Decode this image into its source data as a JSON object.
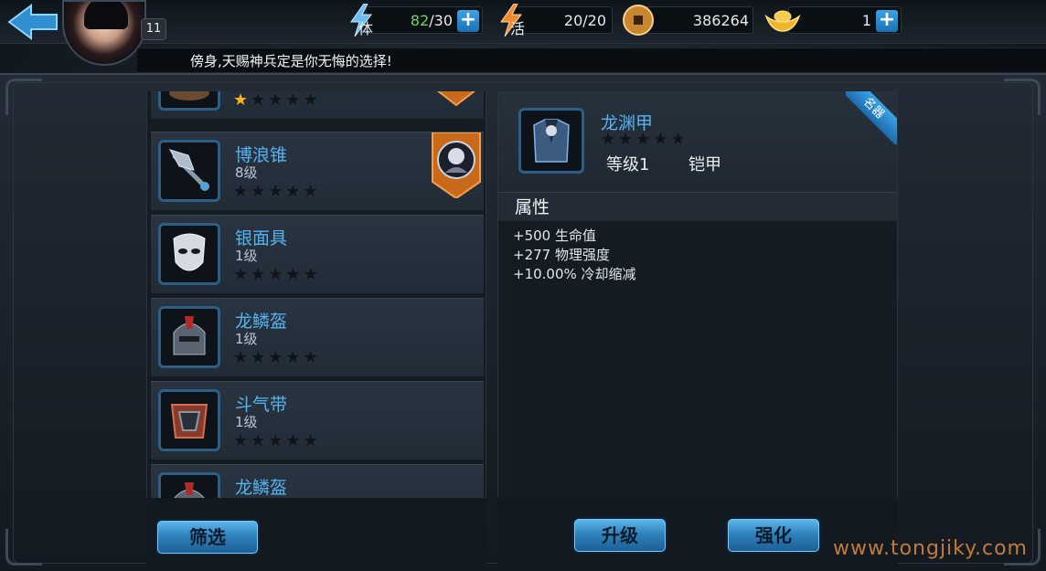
{
  "header": {
    "player_level": "11",
    "stamina": {
      "tag": "体",
      "current": "82",
      "max": "/30"
    },
    "vitality": {
      "tag": "活",
      "value": "20/20"
    },
    "coins": "386264",
    "gold": "1"
  },
  "ticker": "傍身,天赐神兵定是你无悔的选择!",
  "equipment_list": [
    {
      "name": "",
      "level": "",
      "stars": 1
    },
    {
      "name": "博浪锥",
      "level": "8级",
      "stars": 0,
      "equipped": true
    },
    {
      "name": "银面具",
      "level": "1级",
      "stars": 0
    },
    {
      "name": "龙鳞盔",
      "level": "1级",
      "stars": 0
    },
    {
      "name": "斗气带",
      "level": "1级",
      "stars": 0
    },
    {
      "name": "龙鳞盔",
      "level": "",
      "stars": 0
    }
  ],
  "detail": {
    "name": "龙渊甲",
    "level": "等级1",
    "type": "铠甲",
    "ribbon": "名器",
    "attr_title": "属性",
    "attributes": [
      "+500 生命值",
      "+277 物理强度",
      "+10.00% 冷却缩减"
    ]
  },
  "buttons": {
    "filter": "筛选",
    "upgrade": "升级",
    "enhance": "强化"
  },
  "watermark": "www.tongjiky.com",
  "colors": {
    "accent_blue": "#55b3f0",
    "star_gold": "#f5b417",
    "button_blue": "#2f82bd",
    "stamina_green": "#6fd36b",
    "watermark_orange": "#c27a3a"
  }
}
